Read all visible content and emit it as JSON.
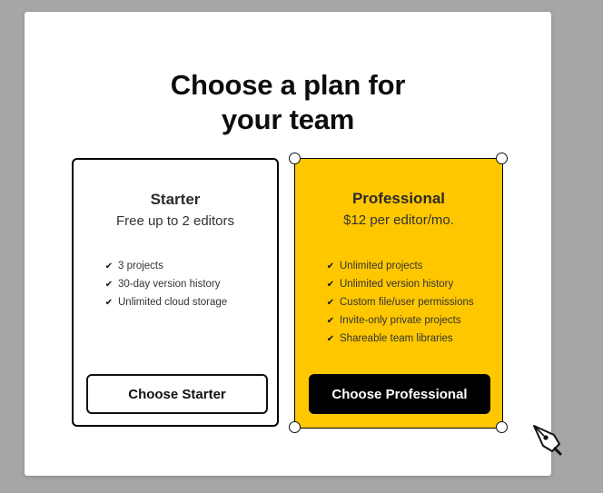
{
  "modal": {
    "title": "Choose a plan for\nyour team"
  },
  "plans": [
    {
      "name": "Starter",
      "price": "Free up to 2 editors",
      "features": [
        "3 projects",
        "30-day version history",
        "Unlimited cloud storage"
      ],
      "button_label": "Choose Starter"
    },
    {
      "name": "Professional",
      "price": "$12 per editor/mo.",
      "features": [
        "Unlimited projects",
        "Unlimited version history",
        "Custom file/user permissions",
        "Invite-only private projects",
        "Shareable team libraries"
      ],
      "button_label": "Choose Professional"
    }
  ],
  "colors": {
    "backdrop": "#a6a6a6",
    "professional_card": "#ffc700",
    "primary_button": "#000000"
  },
  "icons": {
    "feature_check": "check-icon",
    "cursor": "pen-tool-cursor-icon",
    "selection_handle": "selection-handle"
  }
}
